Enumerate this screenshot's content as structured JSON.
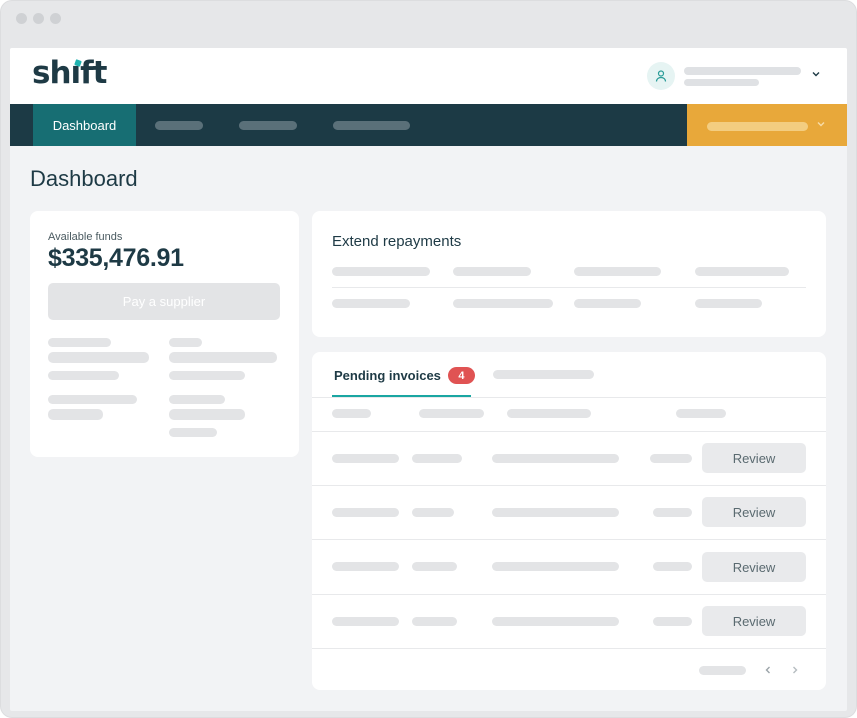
{
  "nav": {
    "active_tab": "Dashboard"
  },
  "page": {
    "title": "Dashboard"
  },
  "funds": {
    "label": "Available funds",
    "amount": "$335,476.91",
    "button_label": "Pay a supplier"
  },
  "repayments": {
    "title": "Extend repayments"
  },
  "invoices": {
    "tab_label": "Pending invoices",
    "count": "4",
    "rows": [
      {
        "action": "Review"
      },
      {
        "action": "Review"
      },
      {
        "action": "Review"
      },
      {
        "action": "Review"
      }
    ]
  },
  "colors": {
    "nav_background": "#1c3a45",
    "nav_active": "#176e73",
    "cta": "#e8a83a",
    "badge": "#e05353",
    "accent": "#1aa6a2"
  },
  "icons": [
    "user-icon",
    "chevron-down-icon",
    "chevron-left-icon",
    "chevron-right-icon"
  ]
}
